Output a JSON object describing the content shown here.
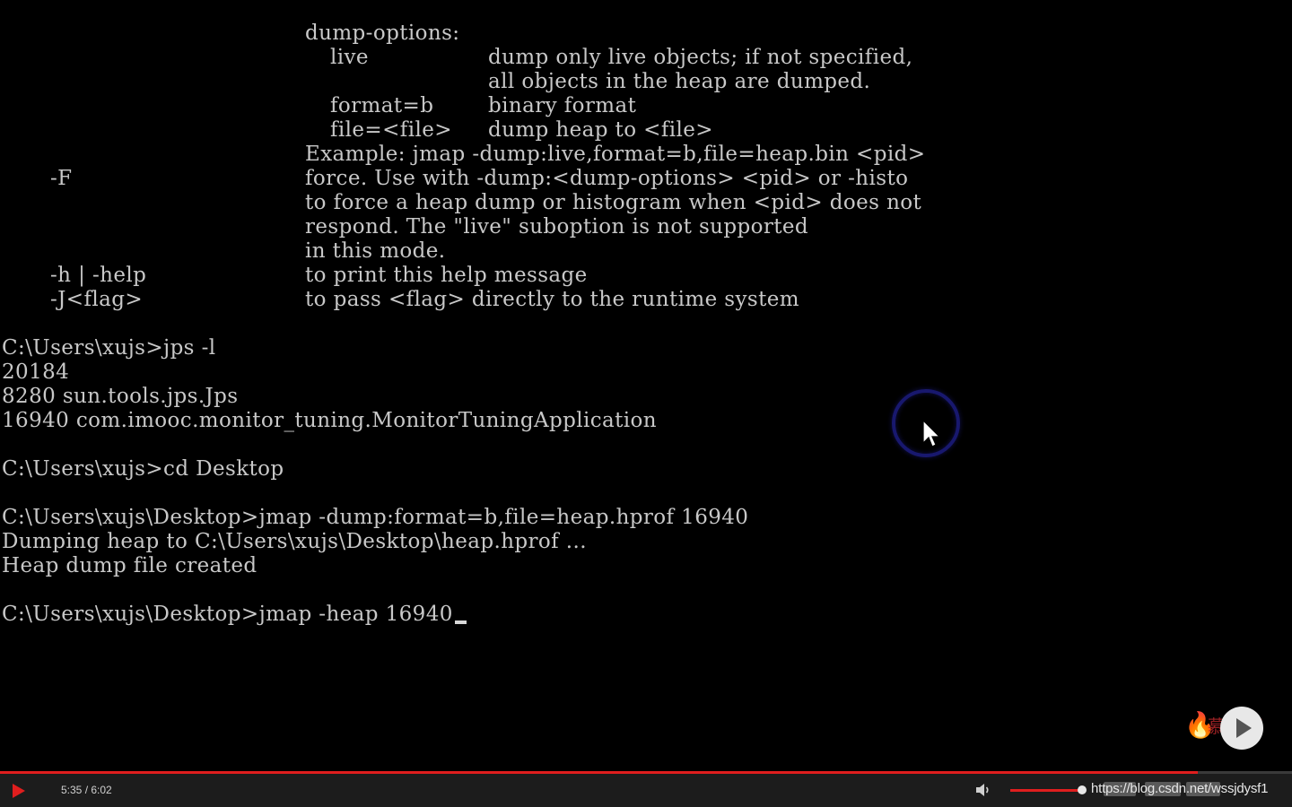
{
  "terminal": {
    "lines": [
      {
        "c0": "",
        "flag": "",
        "desc": "dump-options:",
        "sub": "",
        "subdesc": ""
      },
      {
        "c0": "",
        "flag": "",
        "desc": "",
        "sub": "live",
        "subdesc": "dump only live objects; if not specified,"
      },
      {
        "c0": "",
        "flag": "",
        "desc": "",
        "sub": "",
        "subdesc": "all objects in the heap are dumped."
      },
      {
        "c0": "",
        "flag": "",
        "desc": "",
        "sub": "format=b",
        "subdesc": "binary format"
      },
      {
        "c0": "",
        "flag": "",
        "desc": "",
        "sub": "file=<file>",
        "subdesc": "dump heap to <file>"
      },
      {
        "c0": "",
        "flag": "",
        "desc": "Example: jmap -dump:live,format=b,file=heap.bin <pid>",
        "sub": "",
        "subdesc": ""
      },
      {
        "c0": "",
        "flag": "-F",
        "desc": "force. Use with -dump:<dump-options> <pid> or -histo",
        "sub": "",
        "subdesc": ""
      },
      {
        "c0": "",
        "flag": "",
        "desc": "to force a heap dump or histogram when <pid> does not",
        "sub": "",
        "subdesc": ""
      },
      {
        "c0": "",
        "flag": "",
        "desc": "respond. The \"live\" suboption is not supported",
        "sub": "",
        "subdesc": ""
      },
      {
        "c0": "",
        "flag": "",
        "desc": "in this mode.",
        "sub": "",
        "subdesc": ""
      },
      {
        "c0": "",
        "flag": "-h | -help",
        "desc": "to print this help message",
        "sub": "",
        "subdesc": ""
      },
      {
        "c0": "",
        "flag": "-J<flag>",
        "desc": "to pass <flag> directly to the runtime system",
        "sub": "",
        "subdesc": ""
      },
      {
        "c0": "",
        "flag": "",
        "desc": "",
        "sub": "",
        "subdesc": ""
      },
      {
        "c0": "C:\\Users\\xujs>jps -l",
        "flag": "",
        "desc": "",
        "sub": "",
        "subdesc": ""
      },
      {
        "c0": "20184",
        "flag": "",
        "desc": "",
        "sub": "",
        "subdesc": ""
      },
      {
        "c0": "8280 sun.tools.jps.Jps",
        "flag": "",
        "desc": "",
        "sub": "",
        "subdesc": ""
      },
      {
        "c0": "16940 com.imooc.monitor_tuning.MonitorTuningApplication",
        "flag": "",
        "desc": "",
        "sub": "",
        "subdesc": ""
      },
      {
        "c0": "",
        "flag": "",
        "desc": "",
        "sub": "",
        "subdesc": ""
      },
      {
        "c0": "C:\\Users\\xujs>cd Desktop",
        "flag": "",
        "desc": "",
        "sub": "",
        "subdesc": ""
      },
      {
        "c0": "",
        "flag": "",
        "desc": "",
        "sub": "",
        "subdesc": ""
      },
      {
        "c0": "C:\\Users\\xujs\\Desktop>jmap -dump:format=b,file=heap.hprof 16940",
        "flag": "",
        "desc": "",
        "sub": "",
        "subdesc": ""
      },
      {
        "c0": "Dumping heap to C:\\Users\\xujs\\Desktop\\heap.hprof ...",
        "flag": "",
        "desc": "",
        "sub": "",
        "subdesc": ""
      },
      {
        "c0": "Heap dump file created",
        "flag": "",
        "desc": "",
        "sub": "",
        "subdesc": ""
      },
      {
        "c0": "",
        "flag": "",
        "desc": "",
        "sub": "",
        "subdesc": ""
      },
      {
        "c0": "C:\\Users\\xujs\\Desktop>jmap -heap 16940",
        "flag": "",
        "desc": "",
        "sub": "",
        "subdesc": ""
      }
    ],
    "cursor_line_index": 24
  },
  "player": {
    "time_display": "5:35 / 6:02",
    "progress_fraction": 0.927,
    "volume_fraction": 1.0,
    "url_overlay": "https://blog.csdn.net/wssjdysf1",
    "accent_color": "#e01e1e",
    "icons": {
      "play": "play-icon",
      "volume": "volume-icon",
      "overlay_play": "play-circle-icon"
    }
  },
  "watermark": {
    "text": "慕课网",
    "icon": "flame-logo-icon"
  }
}
